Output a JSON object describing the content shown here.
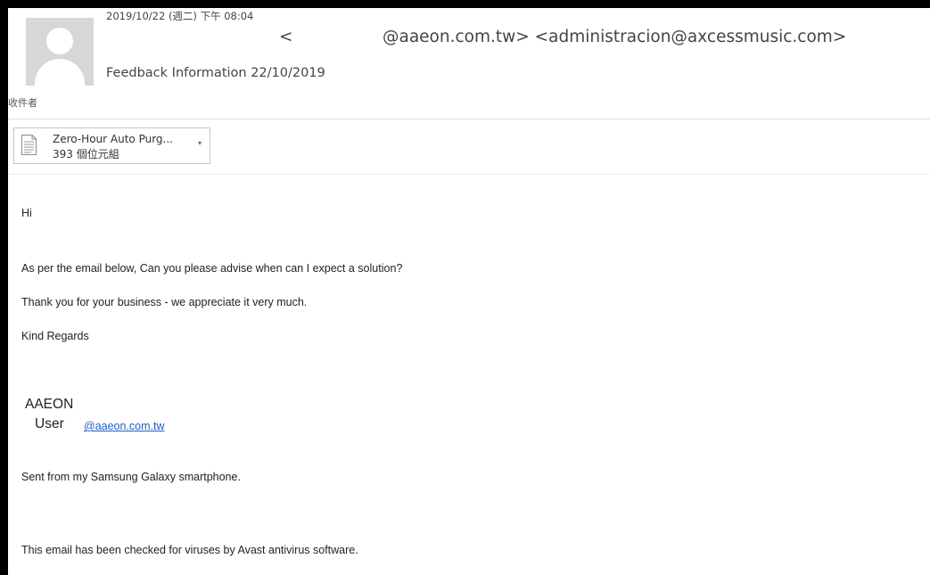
{
  "header": {
    "date": "2019/10/22 (週二) 下午 08:04",
    "sender_open": "<",
    "sender_addresses": "@aaeon.com.tw> <administracion@axcessmusic.com>",
    "subject": "Feedback Information 22/10/2019",
    "recipient_label": "收件者"
  },
  "attachment": {
    "name": "Zero-Hour Auto Purg...",
    "size": "393 個位元組",
    "icon": "document-icon"
  },
  "body": {
    "greeting": "Hi",
    "line1": "As per the email below, Can you please advise when can I expect a solution?",
    "line2": "Thank you for your business - we appreciate it very much.",
    "closing": "Kind Regards",
    "signature_company": "AAEON",
    "signature_user": "User",
    "signature_email": "@aaeon.com.tw",
    "sent_from": "Sent from my Samsung Galaxy smartphone.",
    "antivirus": "This email has been checked for viruses by Avast antivirus software."
  },
  "colors": {
    "link": "#1f5fbf",
    "avatar_bg": "#d7d7d7"
  }
}
